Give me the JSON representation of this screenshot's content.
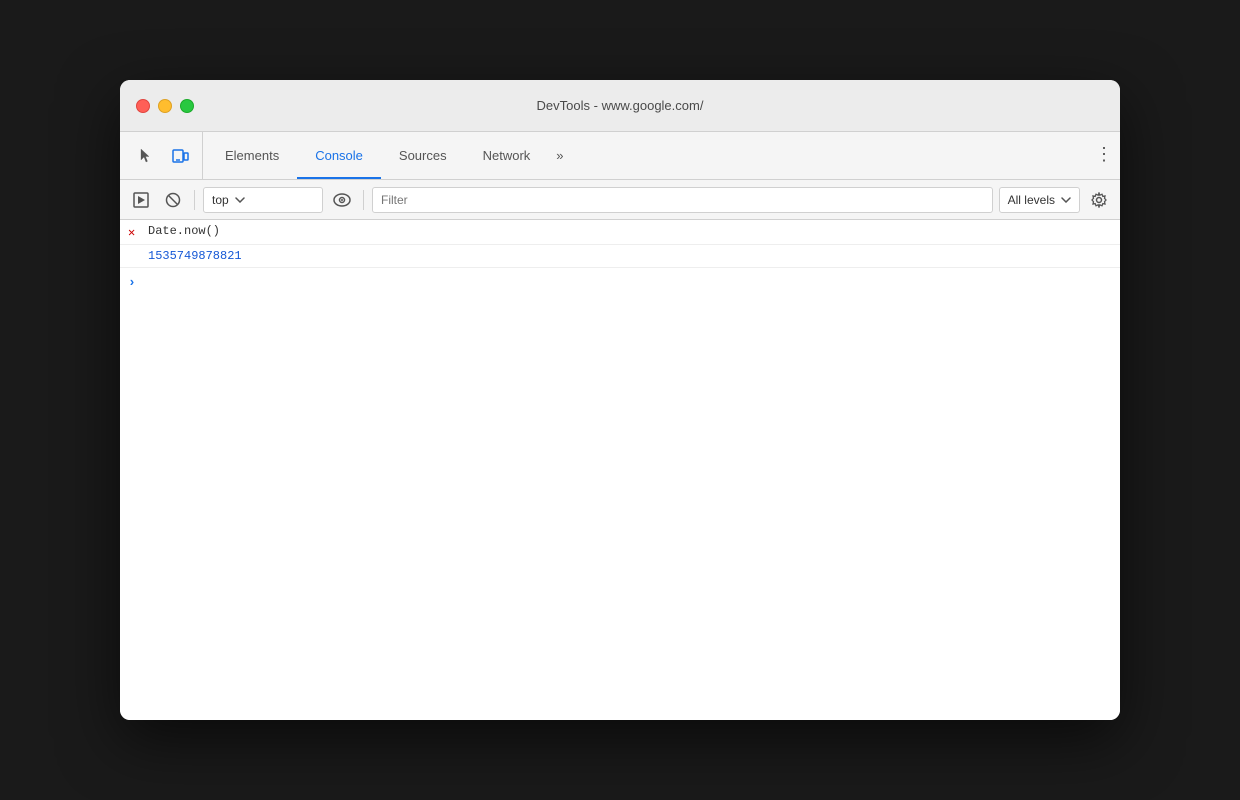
{
  "window": {
    "title": "DevTools - www.google.com/"
  },
  "tabs": {
    "elements_label": "Elements",
    "console_label": "Console",
    "sources_label": "Sources",
    "network_label": "Network",
    "more_label": "»"
  },
  "toolbar": {
    "context_value": "top",
    "filter_placeholder": "Filter",
    "levels_label": "All levels"
  },
  "console": {
    "command_text": "Date.now()",
    "result_text": "1535749878821",
    "input_placeholder": ""
  },
  "colors": {
    "active_tab": "#1a73e8",
    "result_color": "#1558d6",
    "prompt_color": "#1a73e8",
    "error_icon_color": "#c00",
    "border": "#d0d0d0"
  }
}
